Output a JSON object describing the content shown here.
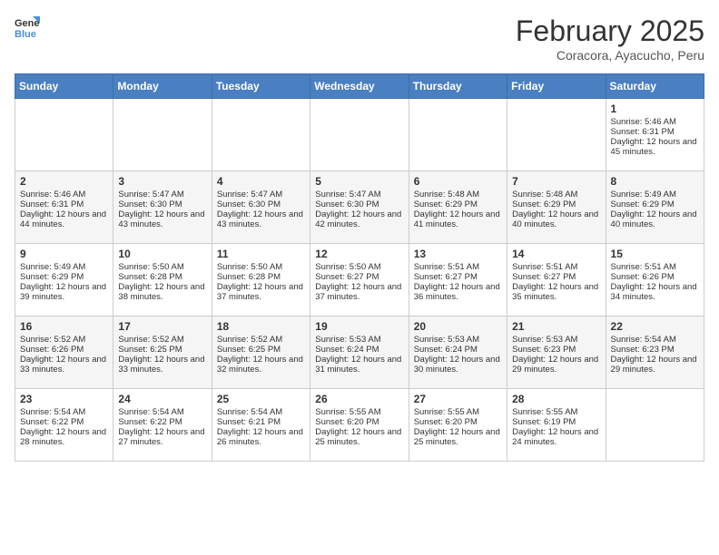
{
  "header": {
    "logo_line1": "General",
    "logo_line2": "Blue",
    "month": "February 2025",
    "location": "Coracora, Ayacucho, Peru"
  },
  "days_of_week": [
    "Sunday",
    "Monday",
    "Tuesday",
    "Wednesday",
    "Thursday",
    "Friday",
    "Saturday"
  ],
  "weeks": [
    [
      {
        "day": "",
        "info": ""
      },
      {
        "day": "",
        "info": ""
      },
      {
        "day": "",
        "info": ""
      },
      {
        "day": "",
        "info": ""
      },
      {
        "day": "",
        "info": ""
      },
      {
        "day": "",
        "info": ""
      },
      {
        "day": "1",
        "info": "Sunrise: 5:46 AM\nSunset: 6:31 PM\nDaylight: 12 hours and 45 minutes."
      }
    ],
    [
      {
        "day": "2",
        "info": "Sunrise: 5:46 AM\nSunset: 6:31 PM\nDaylight: 12 hours and 44 minutes."
      },
      {
        "day": "3",
        "info": "Sunrise: 5:47 AM\nSunset: 6:30 PM\nDaylight: 12 hours and 43 minutes."
      },
      {
        "day": "4",
        "info": "Sunrise: 5:47 AM\nSunset: 6:30 PM\nDaylight: 12 hours and 43 minutes."
      },
      {
        "day": "5",
        "info": "Sunrise: 5:47 AM\nSunset: 6:30 PM\nDaylight: 12 hours and 42 minutes."
      },
      {
        "day": "6",
        "info": "Sunrise: 5:48 AM\nSunset: 6:29 PM\nDaylight: 12 hours and 41 minutes."
      },
      {
        "day": "7",
        "info": "Sunrise: 5:48 AM\nSunset: 6:29 PM\nDaylight: 12 hours and 40 minutes."
      },
      {
        "day": "8",
        "info": "Sunrise: 5:49 AM\nSunset: 6:29 PM\nDaylight: 12 hours and 40 minutes."
      }
    ],
    [
      {
        "day": "9",
        "info": "Sunrise: 5:49 AM\nSunset: 6:29 PM\nDaylight: 12 hours and 39 minutes."
      },
      {
        "day": "10",
        "info": "Sunrise: 5:50 AM\nSunset: 6:28 PM\nDaylight: 12 hours and 38 minutes."
      },
      {
        "day": "11",
        "info": "Sunrise: 5:50 AM\nSunset: 6:28 PM\nDaylight: 12 hours and 37 minutes."
      },
      {
        "day": "12",
        "info": "Sunrise: 5:50 AM\nSunset: 6:27 PM\nDaylight: 12 hours and 37 minutes."
      },
      {
        "day": "13",
        "info": "Sunrise: 5:51 AM\nSunset: 6:27 PM\nDaylight: 12 hours and 36 minutes."
      },
      {
        "day": "14",
        "info": "Sunrise: 5:51 AM\nSunset: 6:27 PM\nDaylight: 12 hours and 35 minutes."
      },
      {
        "day": "15",
        "info": "Sunrise: 5:51 AM\nSunset: 6:26 PM\nDaylight: 12 hours and 34 minutes."
      }
    ],
    [
      {
        "day": "16",
        "info": "Sunrise: 5:52 AM\nSunset: 6:26 PM\nDaylight: 12 hours and 33 minutes."
      },
      {
        "day": "17",
        "info": "Sunrise: 5:52 AM\nSunset: 6:25 PM\nDaylight: 12 hours and 33 minutes."
      },
      {
        "day": "18",
        "info": "Sunrise: 5:52 AM\nSunset: 6:25 PM\nDaylight: 12 hours and 32 minutes."
      },
      {
        "day": "19",
        "info": "Sunrise: 5:53 AM\nSunset: 6:24 PM\nDaylight: 12 hours and 31 minutes."
      },
      {
        "day": "20",
        "info": "Sunrise: 5:53 AM\nSunset: 6:24 PM\nDaylight: 12 hours and 30 minutes."
      },
      {
        "day": "21",
        "info": "Sunrise: 5:53 AM\nSunset: 6:23 PM\nDaylight: 12 hours and 29 minutes."
      },
      {
        "day": "22",
        "info": "Sunrise: 5:54 AM\nSunset: 6:23 PM\nDaylight: 12 hours and 29 minutes."
      }
    ],
    [
      {
        "day": "23",
        "info": "Sunrise: 5:54 AM\nSunset: 6:22 PM\nDaylight: 12 hours and 28 minutes."
      },
      {
        "day": "24",
        "info": "Sunrise: 5:54 AM\nSunset: 6:22 PM\nDaylight: 12 hours and 27 minutes."
      },
      {
        "day": "25",
        "info": "Sunrise: 5:54 AM\nSunset: 6:21 PM\nDaylight: 12 hours and 26 minutes."
      },
      {
        "day": "26",
        "info": "Sunrise: 5:55 AM\nSunset: 6:20 PM\nDaylight: 12 hours and 25 minutes."
      },
      {
        "day": "27",
        "info": "Sunrise: 5:55 AM\nSunset: 6:20 PM\nDaylight: 12 hours and 25 minutes."
      },
      {
        "day": "28",
        "info": "Sunrise: 5:55 AM\nSunset: 6:19 PM\nDaylight: 12 hours and 24 minutes."
      },
      {
        "day": "",
        "info": ""
      }
    ]
  ]
}
